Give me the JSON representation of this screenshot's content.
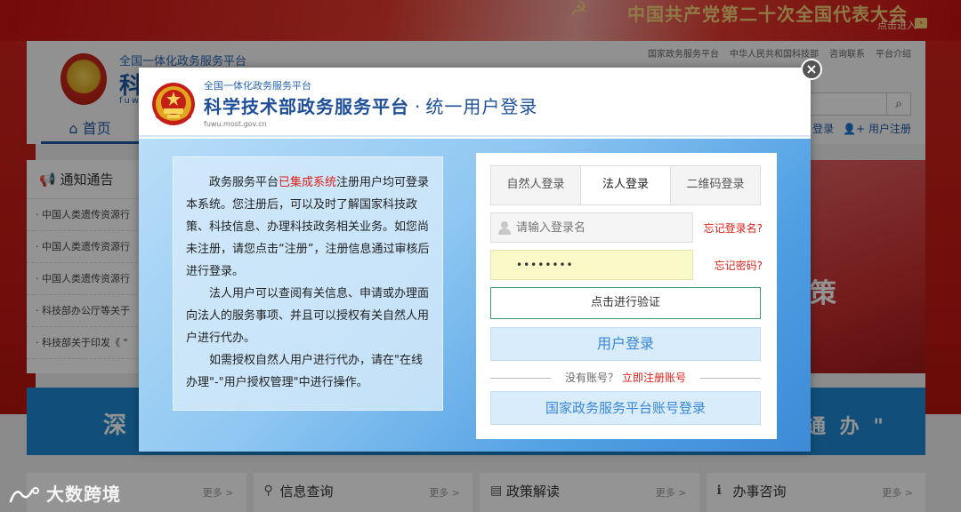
{
  "background": {
    "banner": {
      "title": "中国共产党第二十次全国代表大会",
      "enter": "点击进入",
      "enter_icon": "arrow-right-icon"
    },
    "header": {
      "subtitle": "全国一体化政务服务平台",
      "main_title": "科",
      "url": "fuwu",
      "toplinks": [
        "国家政务服务平台",
        "中华人民共和国科技部",
        "咨询联系",
        "平台介绍"
      ],
      "nav_home": "首页",
      "nav_login": "登录",
      "nav_register": "用户注册"
    },
    "notice": {
      "title": "通知通告",
      "items": [
        "· 中国人类遗传资源行",
        "· 中国人类遗传资源行",
        "· 中国人类遗传资源行",
        "· 科技部办公厅等关于",
        "· 科技部关于印发《 \""
      ]
    },
    "right_image_text": "策",
    "blue_banner": {
      "left_text": "深",
      "right_text": "通 办 \""
    },
    "bottom": [
      {
        "title": "",
        "more": "更多 >"
      },
      {
        "title": "信息查询",
        "more": "更多 >"
      },
      {
        "title": "政策解读",
        "more": "更多 >"
      },
      {
        "title": "办事咨询",
        "more": "更多 >"
      }
    ],
    "watermark": "大数跨境"
  },
  "modal": {
    "header": {
      "subtitle": "全国一体化政务服务平台",
      "title_main": "科学技术部政务服务平台",
      "title_sep": "·",
      "title_sub": "统一用户登录",
      "url": "fuwu.most.gov.cn"
    },
    "intro": {
      "p1_a": "政务服务平台",
      "p1_highlight": "已集成系统",
      "p1_b": "注册用户均可登录本系统。您注册后，可以及时了解国家科技政策、科技信息、办理科技政务相关业务。如您尚未注册，请您点击“注册”，注册信息通过审核后进行登录。",
      "p2": "法人用户可以查阅有关信息、申请或办理面向法人的服务事项、并且可以授权有关自然人用户进行代办。",
      "p3": "如需授权自然人用户进行代办，请在\"在线办理\"-\"用户授权管理\"中进行操作。"
    },
    "login": {
      "tabs": [
        "自然人登录",
        "法人登录",
        "二维码登录"
      ],
      "active_tab": 1,
      "username_placeholder": "请输入登录名",
      "password_value": "••••••••",
      "forgot_username": "忘记登录名?",
      "forgot_password": "忘记密码?",
      "verify_button": "点击进行验证",
      "login_button": "用户登录",
      "no_account_text": "没有账号？",
      "register_link": "立即注册账号",
      "national_login_button": "国家政务服务平台账号登录"
    },
    "close_icon": "close-icon"
  },
  "colors": {
    "brand_blue": "#1e4f98",
    "accent_red": "#e0201b",
    "button_blue_text": "#3a86d4",
    "verify_border": "#3a9b6c"
  }
}
